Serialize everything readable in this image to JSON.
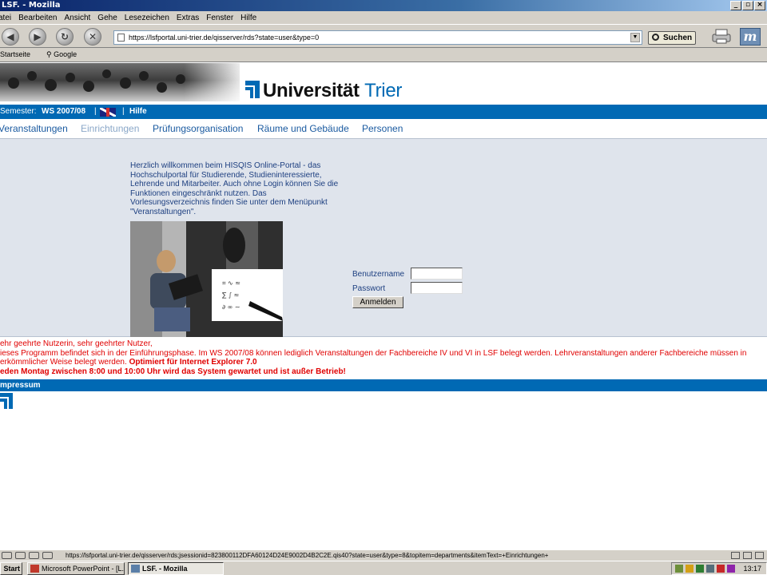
{
  "window": {
    "title": "LSF. - Mozilla"
  },
  "menu": [
    "atei",
    "Bearbeiten",
    "Ansicht",
    "Gehe",
    "Lesezeichen",
    "Extras",
    "Fenster",
    "Hilfe"
  ],
  "toolbar": {
    "url": "https://lsfportal.uni-trier.de/qisserver/rds?state=user&type=0",
    "search_label": "Suchen"
  },
  "bookmarks": [
    "Startseite",
    "Google"
  ],
  "banner": {
    "name_part1": "Universität",
    "name_part2": "Trier"
  },
  "semester_bar": {
    "label": "Semester:",
    "value": "WS 2007/08",
    "separator": "|",
    "help": "Hilfe"
  },
  "nav": [
    "Veranstaltungen",
    "Einrichtungen",
    "Prüfungsorganisation",
    "Räume und Gebäude",
    "Personen"
  ],
  "welcome_text": "Herzlich willkommen beim HISQIS Online-Portal - das Hochschulportal für Studierende, Studieninteressierte, Lehrende und Mitarbeiter. Auch ohne Login können Sie die Funktionen eingeschränkt nutzen. Das Vorlesungsverzeichnis finden Sie unter dem Menüpunkt \"Veranstaltungen\".",
  "login": {
    "username_label": "Benutzername",
    "password_label": "Passwort",
    "submit": "Anmelden"
  },
  "notice": {
    "greeting": "ehr geehrte Nutzerin, sehr geehrter Nutzer,",
    "body_line1": "ieses Programm befindet sich in der Einführungsphase. Im WS 2007/08 können lediglich Veranstaltungen der Fachbereiche IV und VI in LSF belegt werden. Lehrveranstaltungen anderer Fachbereiche müssen in",
    "body_line2": "erkömmlicher Weise belegt werden.",
    "bold1": "Optimiert für Internet Explorer 7.0",
    "bold2": "eden Montag zwischen 8:00 und 10:00 Uhr wird das System gewartet und ist außer Betrieb!"
  },
  "footer": {
    "impressum": "mpressum"
  },
  "status": {
    "url": "https://lsfportal.uni-trier.de/qisserver/rds;jsessionid=823800112DFA60124D24E9002D4B2C2E.qis40?state=user&type=8&topitem=departments&itemText=+Einrichtungen+"
  },
  "taskbar": {
    "start": "Start",
    "tasks": [
      "Microsoft PowerPoint - [L...",
      "LSF. - Mozilla"
    ],
    "clock": "13:17"
  },
  "colors": {
    "brand_blue": "#0069b4",
    "notice_red": "#e00000",
    "panel_bg": "#dfe4ec"
  }
}
